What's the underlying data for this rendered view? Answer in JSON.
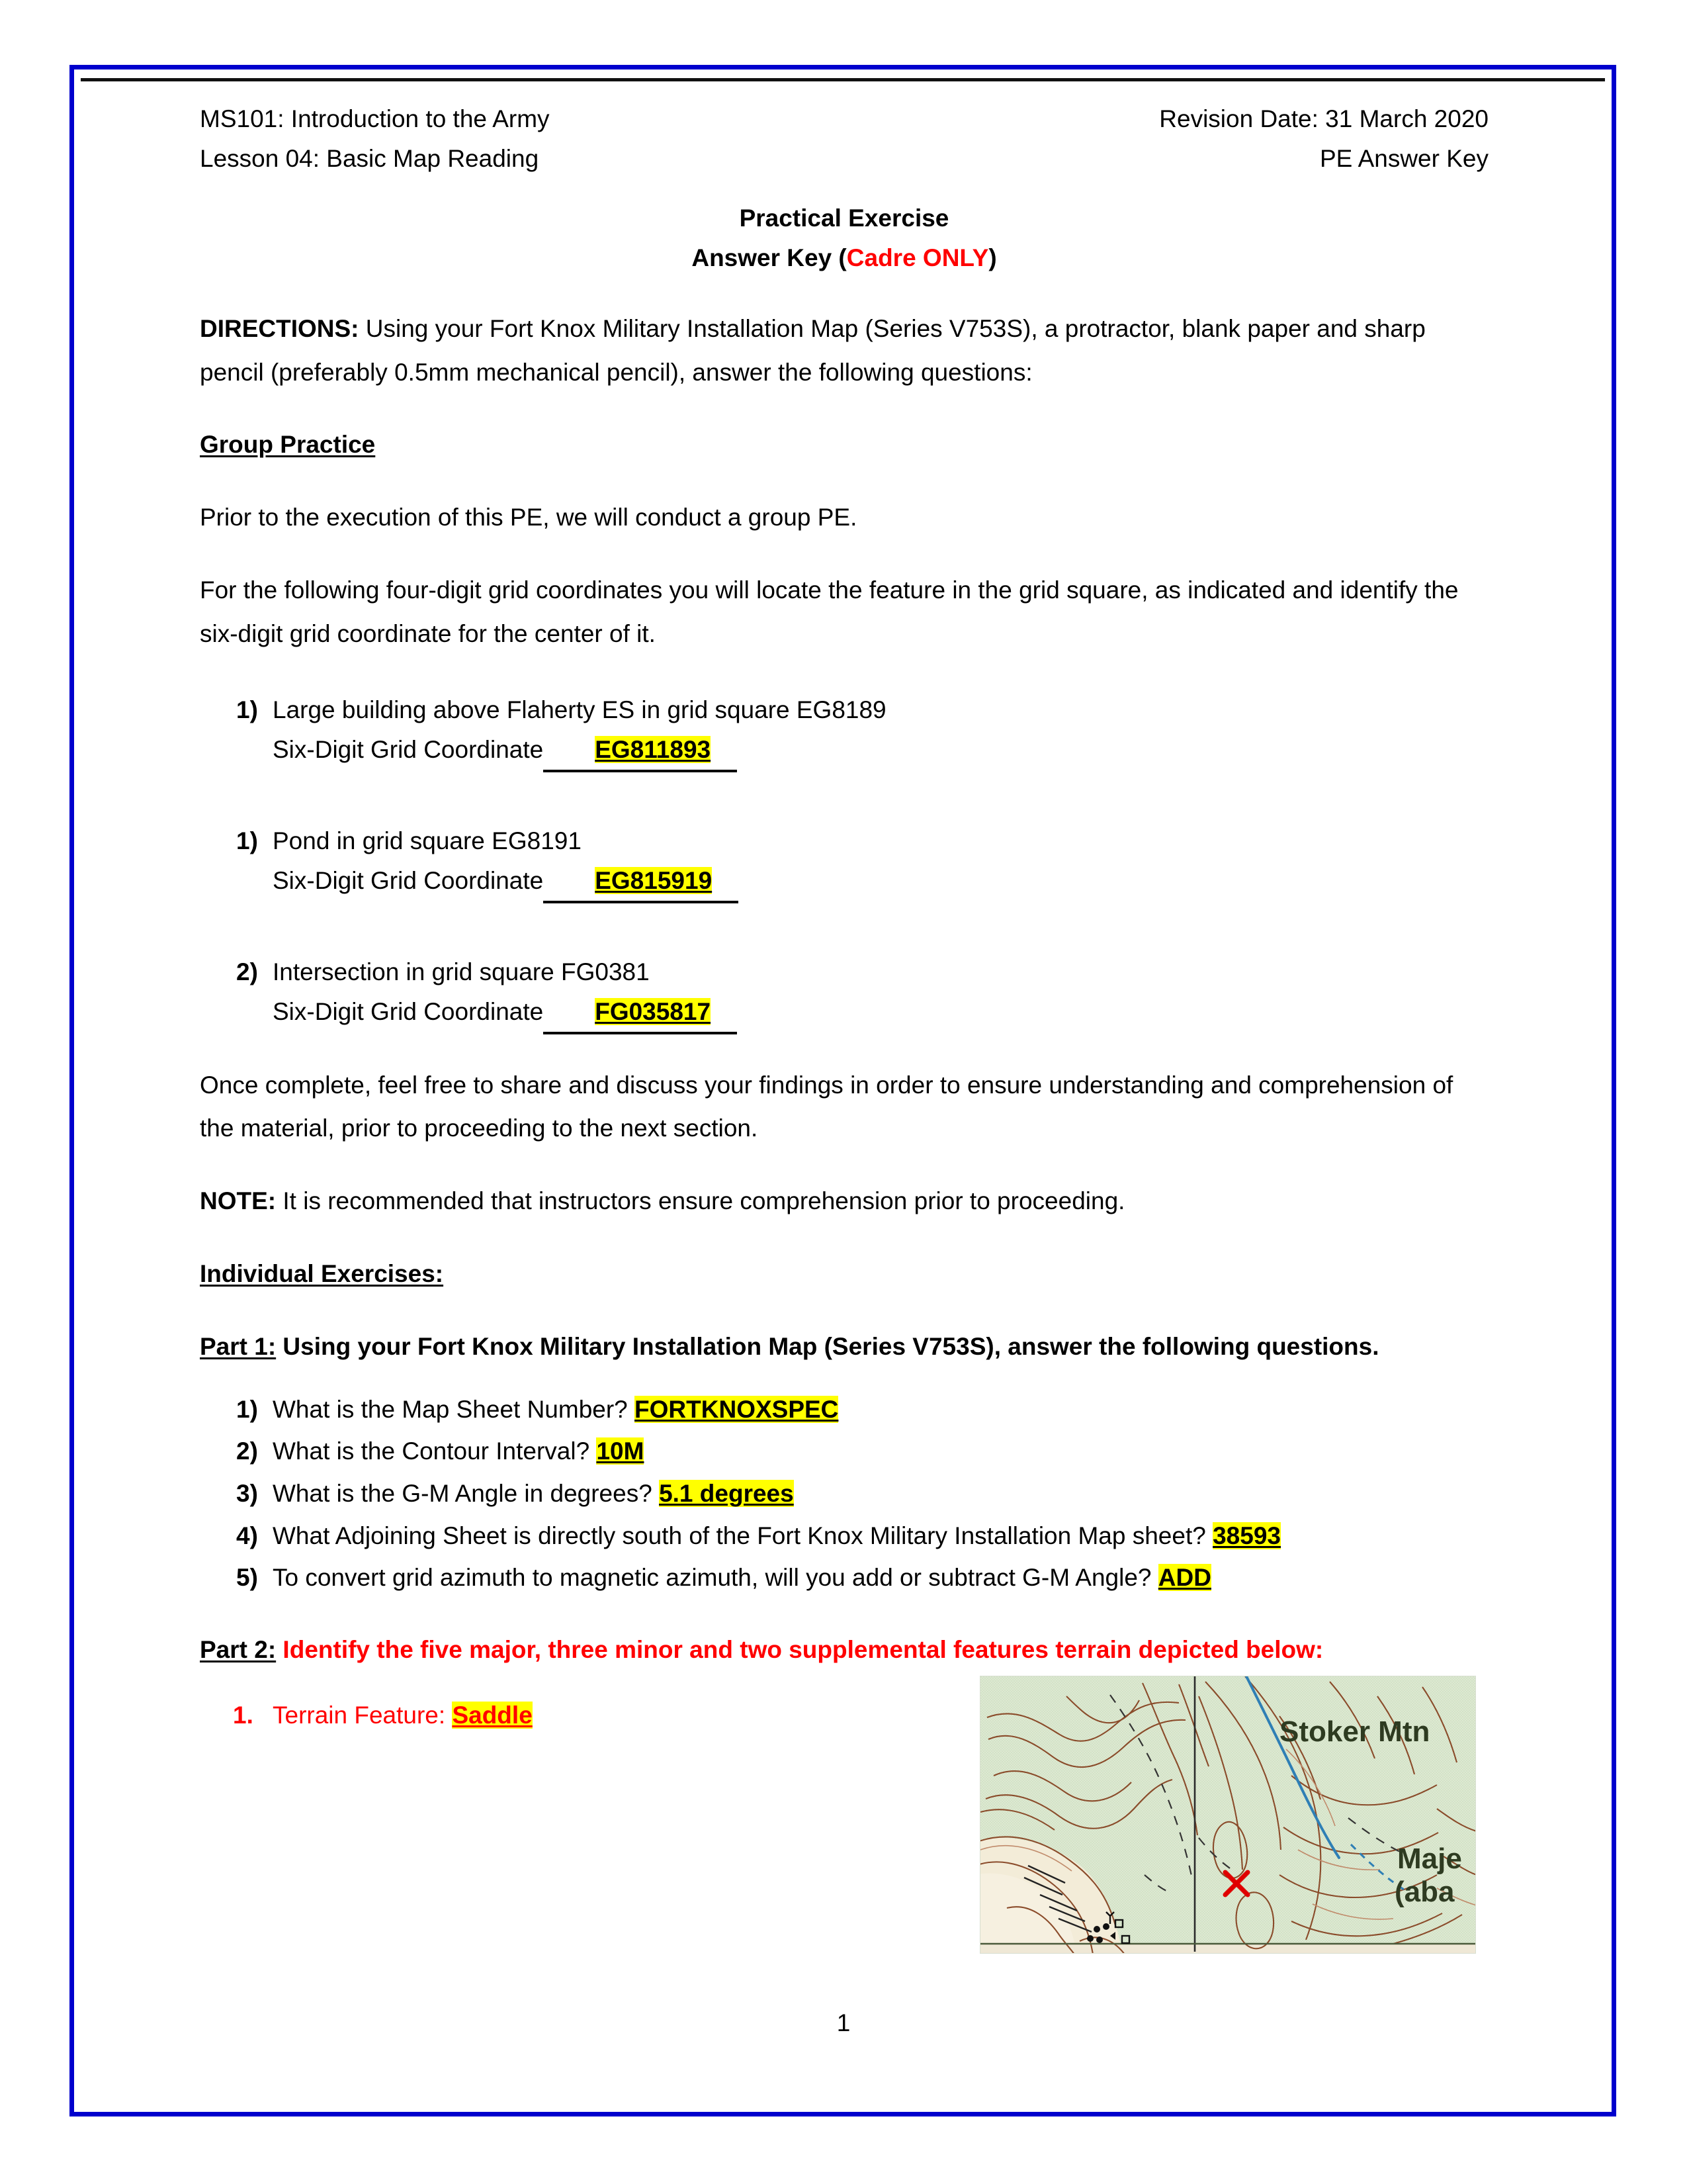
{
  "header": {
    "course": "MS101: Introduction to the Army",
    "lesson": "Lesson 04: Basic Map Reading",
    "revision_date": "Revision Date: 31 March 2020",
    "doc_type": "PE Answer Key",
    "title": "Practical Exercise",
    "subtitle_prefix": "Answer Key (",
    "subtitle_accent": "Cadre ONLY",
    "subtitle_suffix": ")"
  },
  "directions": {
    "label": "DIRECTIONS:",
    "text": " Using your Fort Knox Military Installation Map (Series V753S), a protractor, blank paper and sharp pencil (preferably 0.5mm mechanical pencil), answer the following questions:"
  },
  "group_practice": {
    "heading": "Group Practice",
    "intro": "Prior to the execution of this PE, we will conduct a group PE.",
    "instruction": "For the following four-digit grid coordinates you will locate the feature in the grid square, as indicated and identify the six-digit grid coordinate for the center of it.",
    "coordinate_label": "Six-Digit Grid Coordinate",
    "items": [
      {
        "marker": "1)",
        "question": "Large building above Flaherty ES in grid square EG8189",
        "answer": "EG811893"
      },
      {
        "marker": "1)",
        "question": "Pond in grid square EG8191",
        "answer": "EG815919"
      },
      {
        "marker": "2)",
        "question": "Intersection in grid square FG0381",
        "answer": "FG035817"
      }
    ],
    "closing": "Once complete, feel free to share and discuss your findings in order to ensure understanding and comprehension of the material, prior to proceeding to the next section."
  },
  "note": {
    "label": "NOTE:",
    "text": " It is recommended that instructors ensure comprehension prior to proceeding."
  },
  "individual_exercises": {
    "heading": "Individual Exercises: "
  },
  "part1": {
    "label": "Part 1:",
    "heading": " Using your Fort Knox Military Installation Map (Series V753S), answer the following questions.",
    "questions": [
      {
        "marker": "1)",
        "text": "What is the Map Sheet Number? ",
        "answer": "FORTKNOXSPEC"
      },
      {
        "marker": "2)",
        "text": "What is the Contour Interval? ",
        "answer": "10M"
      },
      {
        "marker": "3)",
        "text": "What is the G-M Angle in degrees?  ",
        "answer": "5.1 degrees"
      },
      {
        "marker": "4)",
        "text": "What Adjoining Sheet is directly south of the Fort Knox Military Installation Map sheet? ",
        "answer": "38593"
      },
      {
        "marker": "5)",
        "text": "To convert grid azimuth to magnetic azimuth, will you add or subtract G-M Angle? ",
        "answer": "ADD"
      }
    ]
  },
  "part2": {
    "label": "Part 2:",
    "heading": " Identify the five major, three minor and two supplemental features terrain depicted below:",
    "items": [
      {
        "marker": "1.",
        "text": "Terrain Feature: ",
        "answer": "Saddle"
      }
    ]
  },
  "map_figure": {
    "label_stoker": "Stoker Mtn",
    "label_maje": "Maje",
    "label_aba": "(aba",
    "marker": "X",
    "marker_color": "#e00000",
    "contour_color": "#8a4b2a",
    "terrain_color": "#dde9d2",
    "clearing_color": "#f3ecd8",
    "stream_color": "#2f7fb5"
  },
  "footer": {
    "page_number": "1"
  },
  "colors": {
    "page_border": "#0000cd",
    "highlight": "#ffff00",
    "accent_red": "#ff0000"
  }
}
